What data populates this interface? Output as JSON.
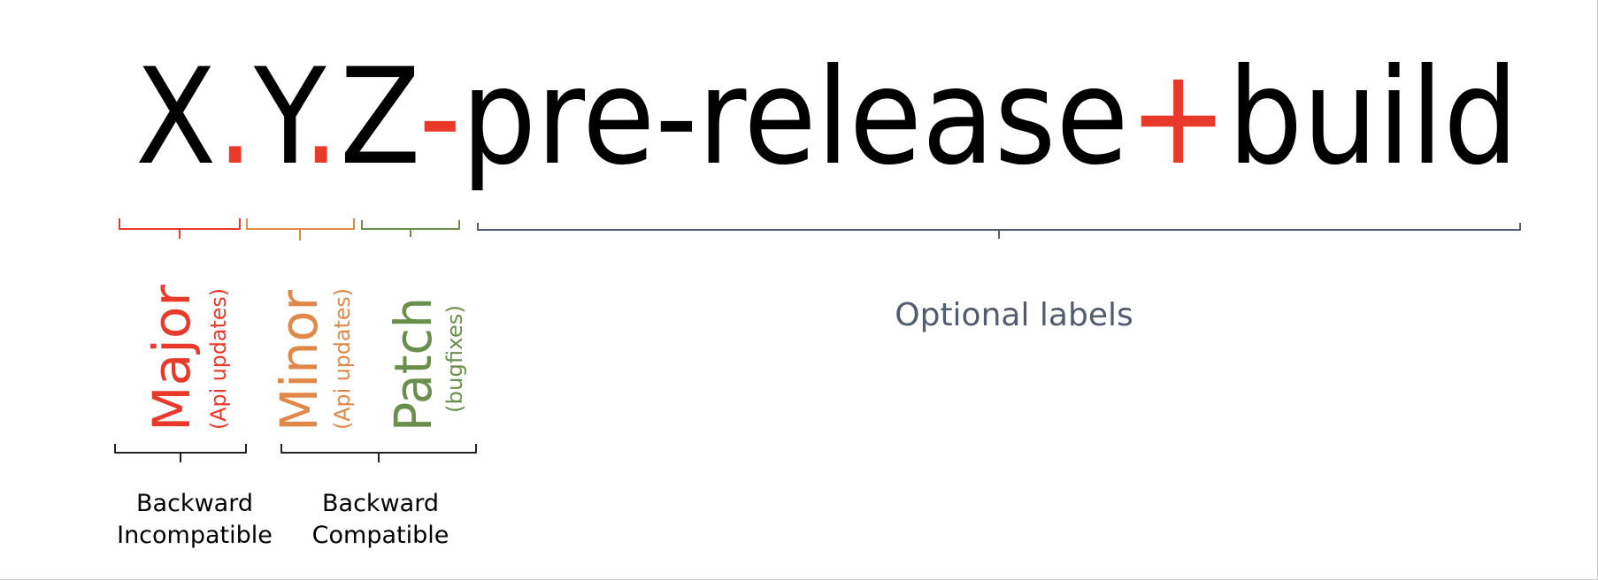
{
  "title": {
    "major": "X",
    "dot1": ".",
    "minor": "Y",
    "dot2": ".",
    "patch": "Z",
    "dash": "-",
    "pre": "pre-release",
    "plus": "+",
    "build": "build"
  },
  "labels": {
    "major": {
      "name": "Major",
      "sub": "(Api updates)"
    },
    "minor": {
      "name": "Minor",
      "sub": "(Api updates)"
    },
    "patch": {
      "name": "Patch",
      "sub": "(bugfixes)"
    },
    "optional": "Optional labels"
  },
  "groups": {
    "incompatible": [
      "Backward",
      "Incompatible"
    ],
    "compatible": [
      "Backward",
      "Compatible"
    ]
  },
  "colors": {
    "text": "#000000",
    "separator": "#e8392a",
    "major": "#e8392a",
    "minor": "#e0884a",
    "patch": "#6a8f4a",
    "optional": "#515c6e"
  }
}
